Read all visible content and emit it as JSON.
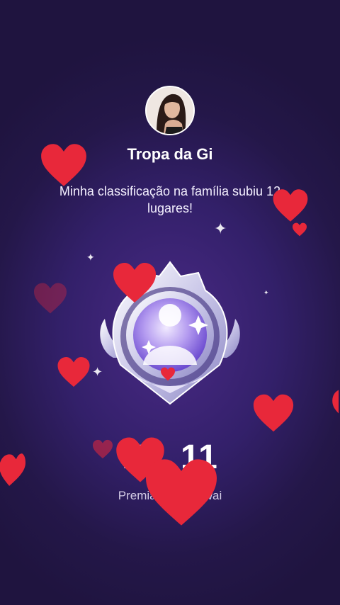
{
  "header": {
    "profile_name": "Tropa da Gi",
    "avatar_icon": "profile-photo",
    "message_text": "Minha classificação na família subiu 12 lugares!"
  },
  "badge": {
    "icon": "family-rank-emblem",
    "rank_text": "Nº. 11"
  },
  "footer": {
    "caption_text": "Premiação do Kwai"
  },
  "decorations": {
    "heart_icon": "heart-icon",
    "sparkle_icon": "sparkle-icon",
    "heart_color": "#e8283a"
  }
}
